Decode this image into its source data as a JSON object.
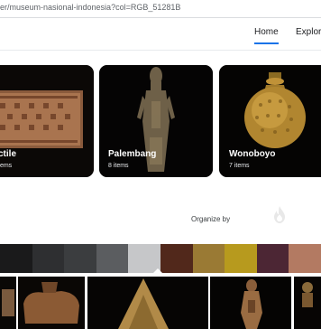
{
  "browser": {
    "url": "er/museum-nasional-indonesia?col=RGB_51281B"
  },
  "nav": {
    "home_label": "Home",
    "explore_label": "Explore"
  },
  "cards": [
    {
      "title": "ctile",
      "count": "tems"
    },
    {
      "title": "Palembang",
      "count": "8 items"
    },
    {
      "title": "Wonoboyo",
      "count": "7 items"
    }
  ],
  "organize": {
    "label": "Organize by",
    "icon": "flame-icon"
  },
  "swatches": [
    {
      "color": "#1a1a1b"
    },
    {
      "color": "#2e2f31"
    },
    {
      "color": "#3b3d3f"
    },
    {
      "color": "#5b5d60"
    },
    {
      "color": "#c6c7c9"
    },
    {
      "color": "#51281b"
    },
    {
      "color": "#9a7a34"
    },
    {
      "color": "#b79a1e"
    },
    {
      "color": "#4c2634"
    },
    {
      "color": "#b37a62"
    }
  ],
  "thumbnails": [
    {
      "icon": "artifact-thumbnail"
    },
    {
      "icon": "vessel-thumbnail"
    },
    {
      "icon": "textile-thumbnail"
    },
    {
      "icon": "statue-thumbnail"
    },
    {
      "icon": "figure-thumbnail"
    }
  ]
}
